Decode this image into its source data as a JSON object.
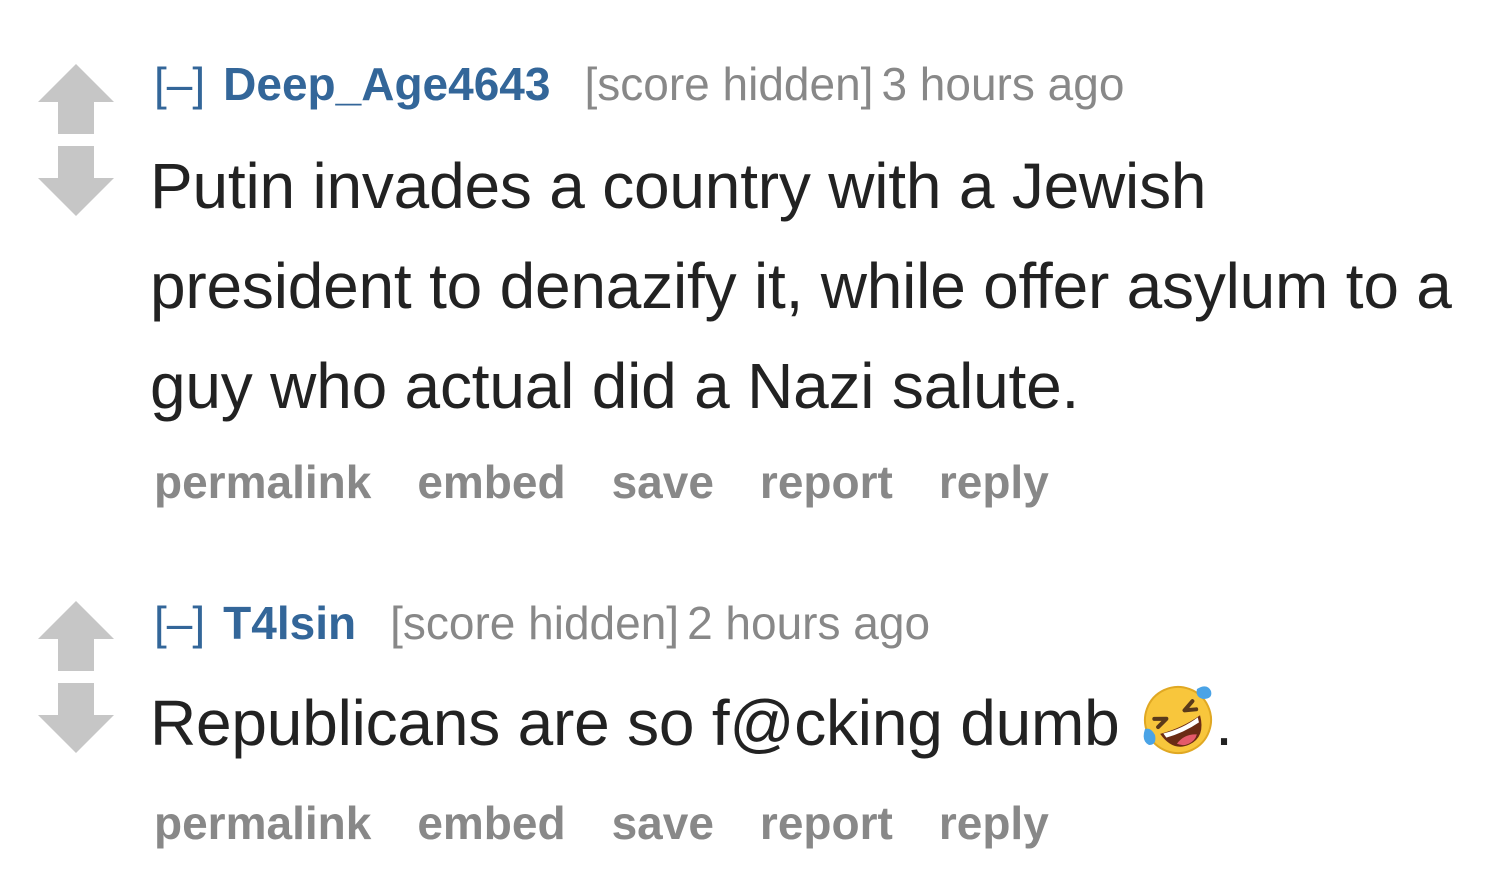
{
  "comments": [
    {
      "expand": "[–]",
      "author": "Deep_Age4643",
      "score": "[score hidden]",
      "time": "3 hours ago",
      "body": "Putin invades a country with a Jewish president to denazify it, while offer asylum to a guy who actual did a Nazi salute.",
      "emoji": "",
      "body_suffix": "",
      "buttons": [
        "permalink",
        "embed",
        "save",
        "report",
        "reply"
      ]
    },
    {
      "expand": "[–]",
      "author": "T4lsin",
      "score": "[score hidden]",
      "time": "2 hours ago",
      "body": "Republicans are so f@cking dumb",
      "emoji": "rolling-on-floor-laughing",
      "body_suffix": ".",
      "buttons": [
        "permalink",
        "embed",
        "save",
        "report",
        "reply"
      ]
    }
  ],
  "colors": {
    "link": "#336699",
    "muted": "#888888",
    "text": "#222222",
    "arrow": "#c6c6c6"
  }
}
